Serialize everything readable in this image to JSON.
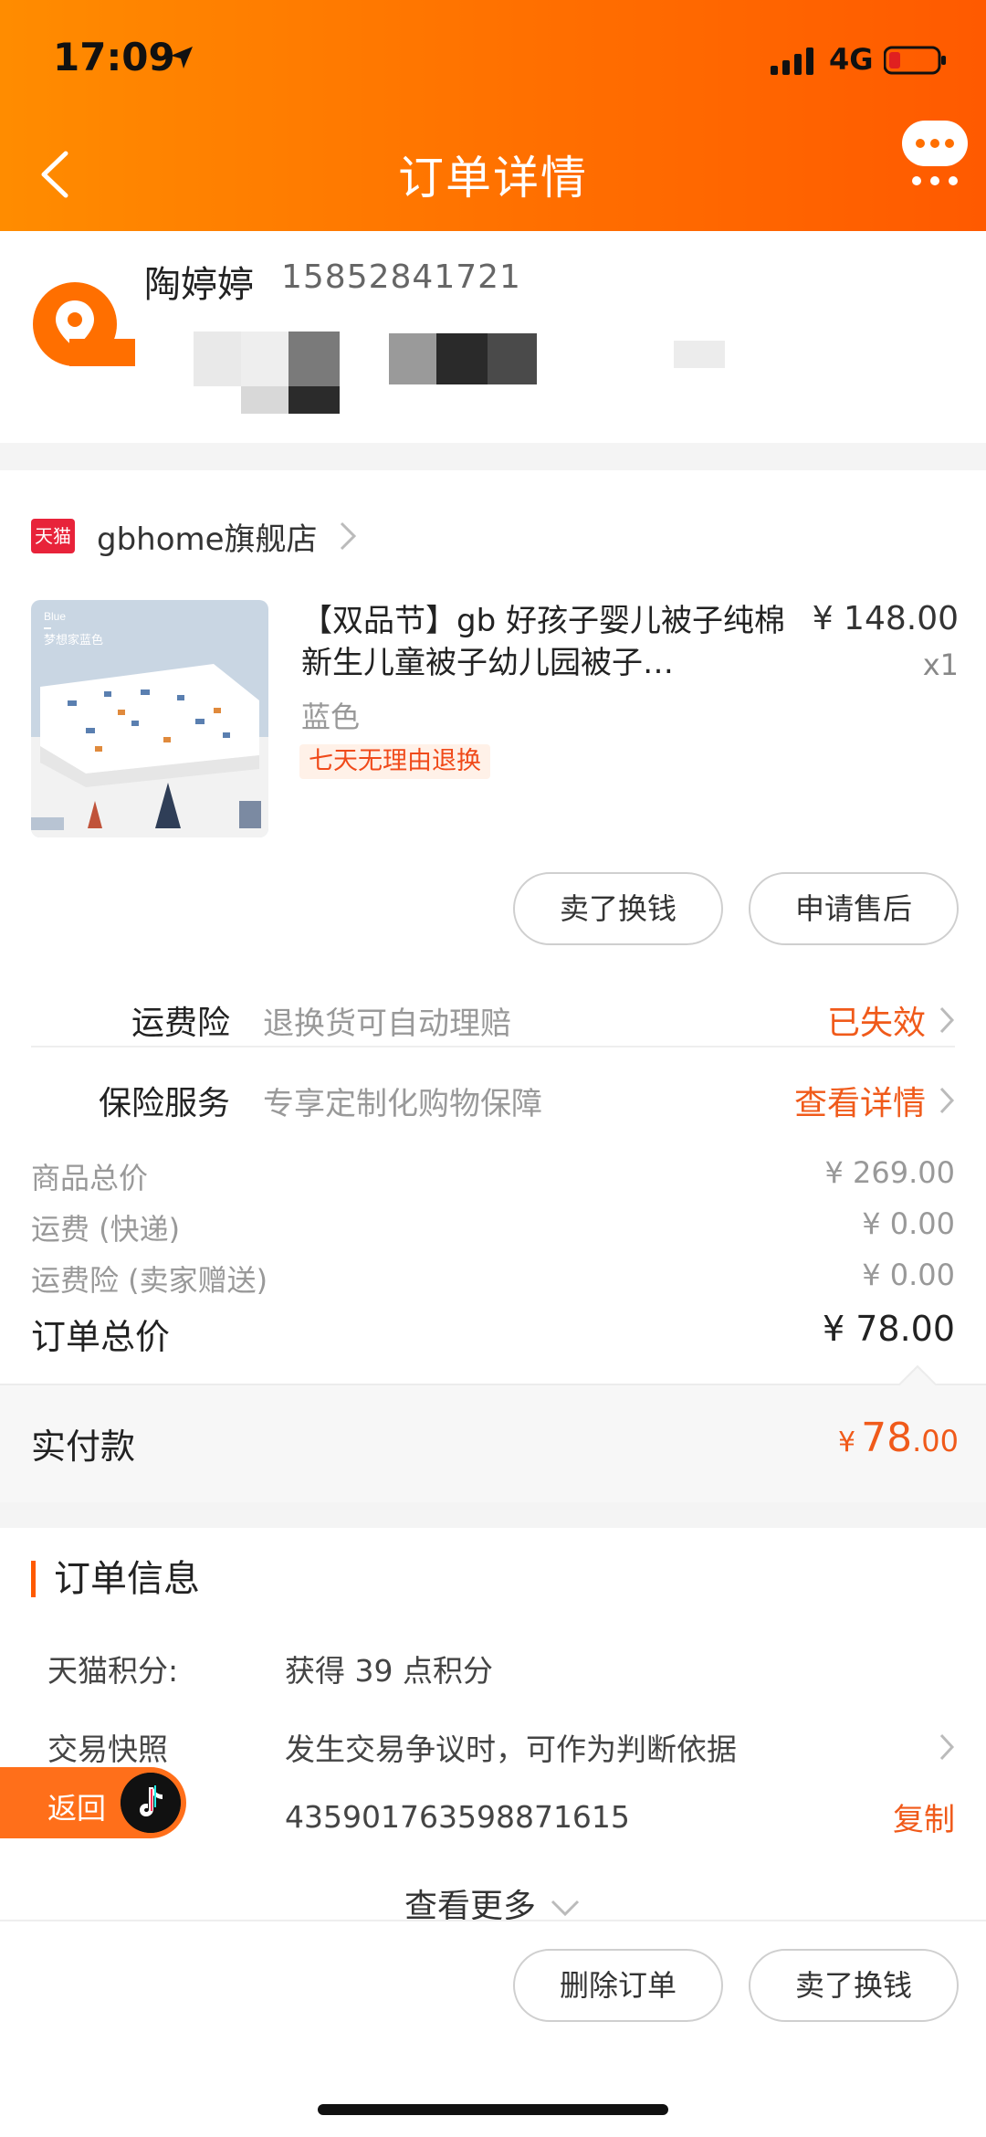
{
  "status": {
    "time": "17:09",
    "network": "4G"
  },
  "header": {
    "title": "订单详情"
  },
  "address": {
    "name": "陶婷婷",
    "phone": "15852841721"
  },
  "shop": {
    "badge": "天猫",
    "name": "gbhome旗舰店"
  },
  "product": {
    "title": "【双品节】gb 好孩子婴儿被子纯棉新生儿童被子幼儿园被子…",
    "price": "¥ 148.00",
    "qty": "x1",
    "spec": "蓝色",
    "return_tag": "七天无理由退换",
    "image_text": "梦想家蓝色",
    "image_text_small": "Blue"
  },
  "actions": {
    "sell": "卖了换钱",
    "after_sale": "申请售后"
  },
  "services": [
    {
      "label": "运费险",
      "desc": "退换货可自动理赔",
      "status": "已失效"
    },
    {
      "label": "保险服务",
      "desc": "专享定制化购物保障",
      "status": "查看详情"
    }
  ],
  "fees": [
    {
      "label": "商品总价",
      "value": "¥ 269.00"
    },
    {
      "label": "运费 (快递)",
      "value": "¥ 0.00"
    },
    {
      "label": "运费险 (卖家赠送)",
      "value": "¥ 0.00"
    }
  ],
  "order_total": {
    "label": "订单总价",
    "value": "¥ 78.00"
  },
  "paid": {
    "label": "实付款",
    "currency": "¥",
    "int": "78",
    "dec": ".00"
  },
  "order_info": {
    "title": "订单信息",
    "points_key": "天猫积分:",
    "points_val": "获得 39 点积分",
    "snapshot_key": "交易快照",
    "snapshot_val": "发生交易争议时，可作为判断依据",
    "order_no": "435901763598871615",
    "copy": "复制",
    "more": "查看更多"
  },
  "float_return": "返回",
  "bottom": {
    "delete": "删除订单",
    "sell": "卖了换钱"
  },
  "colors": {
    "accent": "#ff6f00",
    "price_red": "#f05a1a",
    "tmall_red": "#e8233a"
  }
}
